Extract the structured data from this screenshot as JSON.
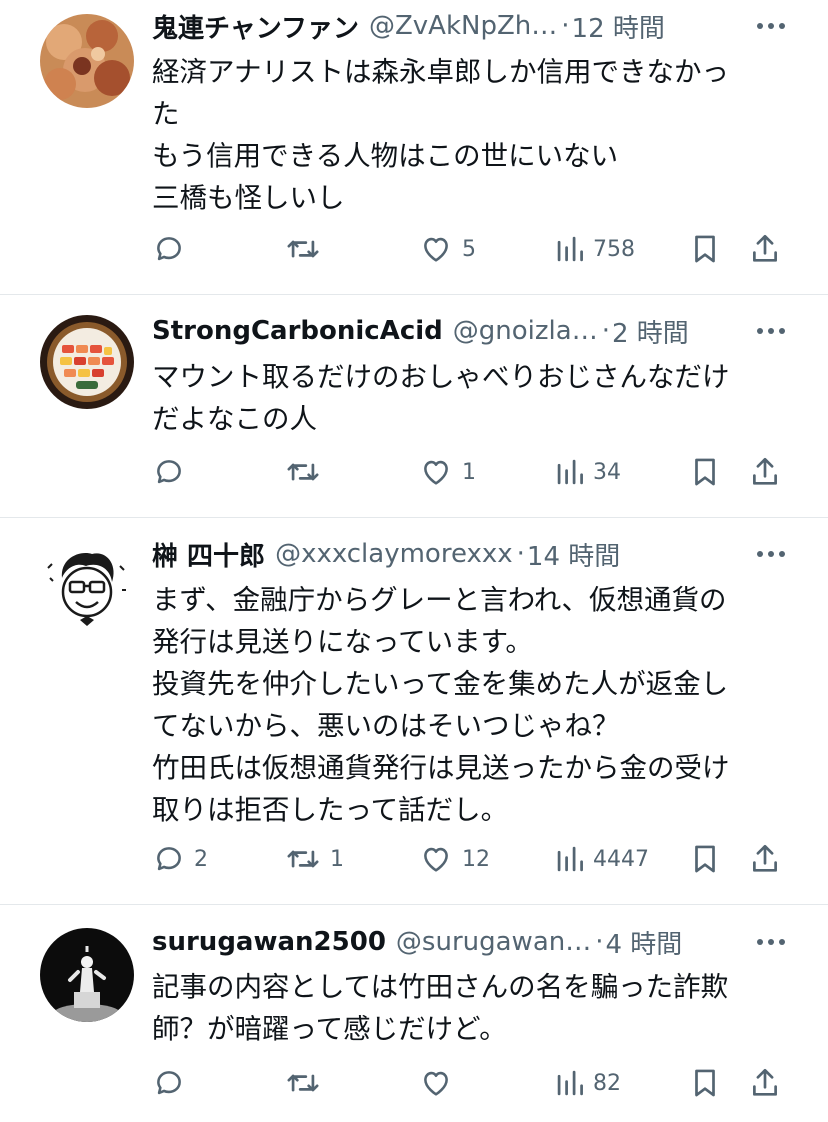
{
  "posts": [
    {
      "name": "鬼連チャンファン",
      "handle": "@ZvAkNpZh…",
      "dot": "·",
      "time": "12 時間",
      "lines": [
        "経済アナリストは森永卓郎しか信用できなかっ",
        "た",
        "もう信用できる人物はこの世にいない",
        "三橋も怪しいし"
      ],
      "replies": "",
      "reposts": "",
      "likes": "5",
      "views": "758"
    },
    {
      "name": "StrongCarbonicAcid",
      "handle": "@gnoizla…",
      "dot": "·",
      "time": "2 時間",
      "lines": [
        "マウント取るだけのおしゃべりおじさんなだけ",
        "だよなこの人"
      ],
      "replies": "",
      "reposts": "",
      "likes": "1",
      "views": "34"
    },
    {
      "name": "榊 四十郎",
      "handle": "@xxxclaymorexxx",
      "dot": "·",
      "time": "14 時間",
      "lines": [
        "まず、金融庁からグレーと言われ、仮想通貨の",
        "発行は見送りになっています。",
        "投資先を仲介したいって金を集めた人が返金し",
        "てないから、悪いのはそいつじゃね？",
        "竹田氏は仮想通貨発行は見送ったから金の受け",
        "取りは拒否したって話だし。"
      ],
      "replies": "2",
      "reposts": "1",
      "likes": "12",
      "views": "4447"
    },
    {
      "name": "surugawan2500",
      "handle": "@surugawan…",
      "dot": "·",
      "time": "4 時間",
      "lines": [
        "記事の内容としては竹田さんの名を騙った詐欺",
        "師？が暗躍って感じだけど。"
      ],
      "replies": "",
      "reposts": "",
      "likes": "",
      "views": "82"
    }
  ],
  "icons": [
    "reply-icon",
    "repost-icon",
    "like-icon",
    "views-icon",
    "bookmark-icon",
    "share-icon",
    "more-icon"
  ],
  "colors": {
    "text": "#0f1419",
    "secondary": "#536471",
    "separator": "#e4e8eb"
  }
}
